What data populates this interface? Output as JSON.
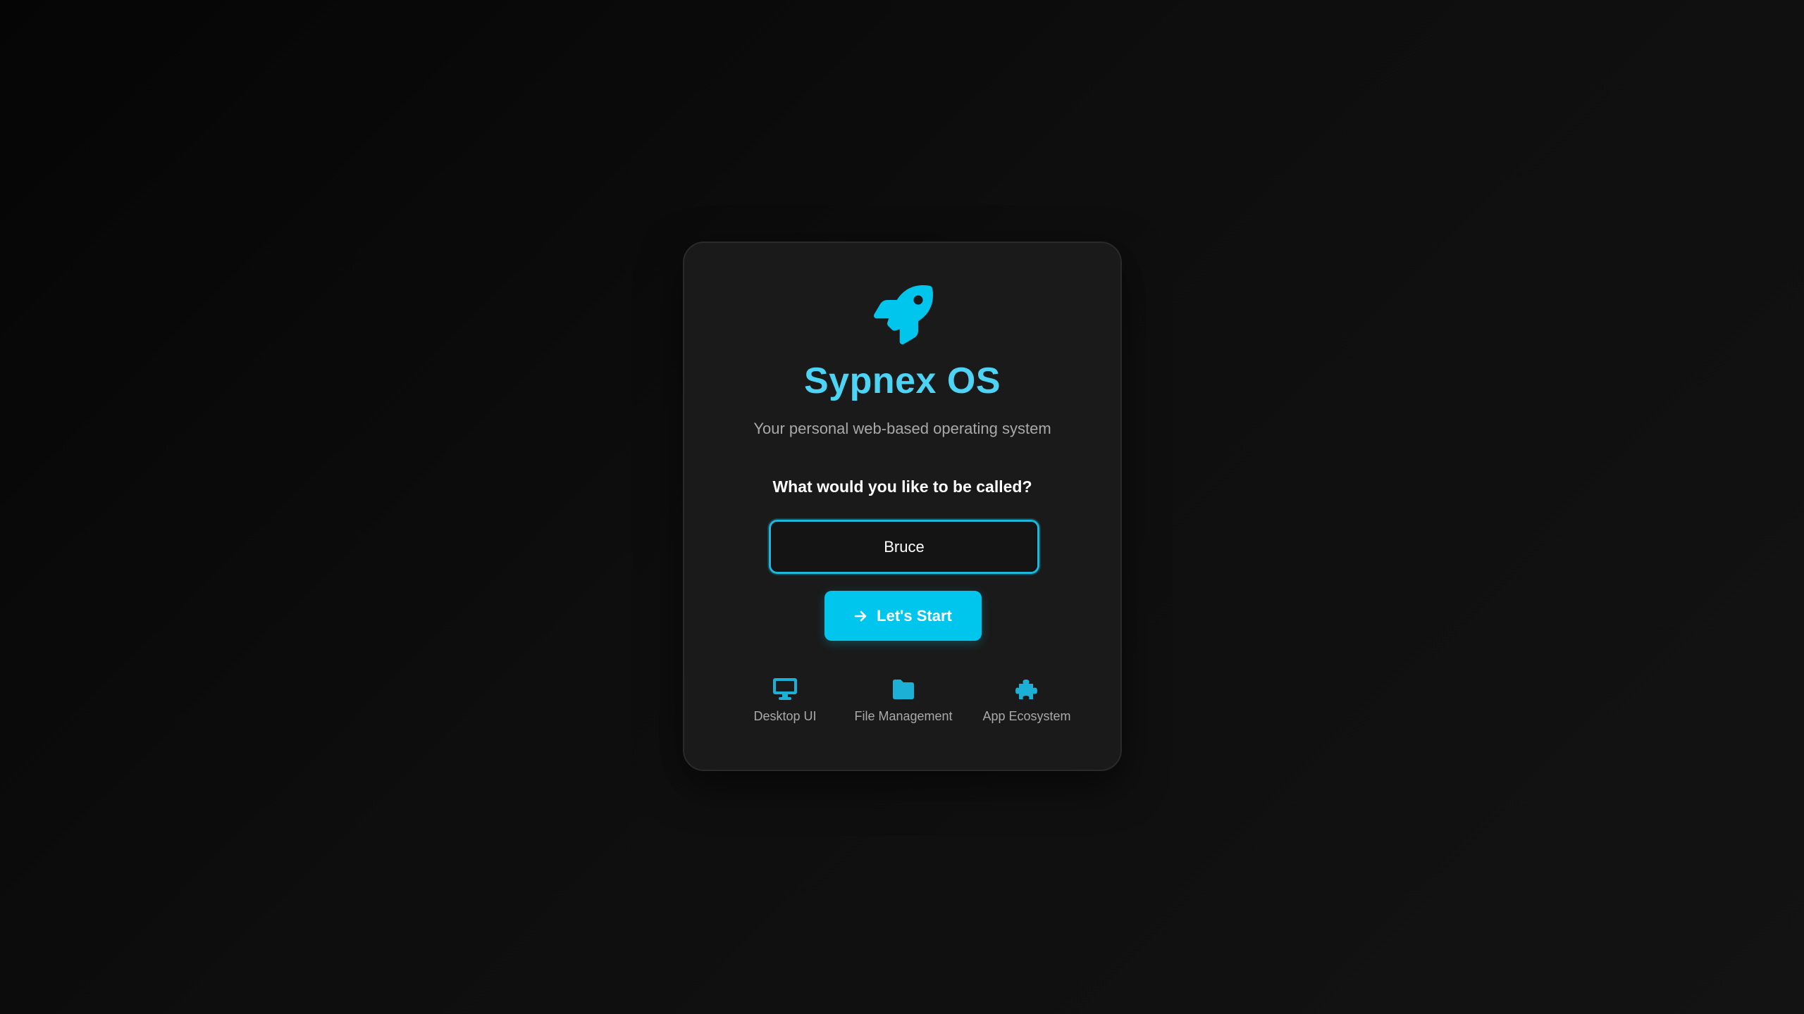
{
  "app": {
    "title": "Sypnex OS",
    "subtitle": "Your personal web-based operating system",
    "logo_icon": "rocket-icon"
  },
  "prompt": {
    "question": "What would you like to be called?"
  },
  "name_input": {
    "value": "Bruce",
    "placeholder": ""
  },
  "start_button": {
    "label": "Let's Start",
    "icon": "arrow-right-icon"
  },
  "features": [
    {
      "label": "Desktop UI",
      "icon": "desktop-icon"
    },
    {
      "label": "File Management",
      "icon": "folder-icon"
    },
    {
      "label": "App Ecosystem",
      "icon": "puzzle-icon"
    }
  ],
  "colors": {
    "accent": "#00c6ee",
    "title": "#4dd4f5",
    "card_background": "#1a1a1a",
    "page_background": "#0a0a0a",
    "muted_text": "#a9a9a9"
  }
}
